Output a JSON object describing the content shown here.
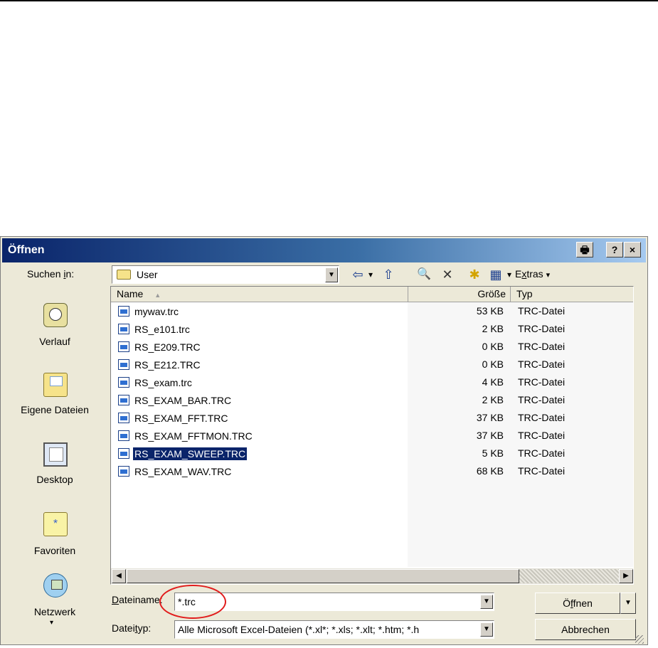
{
  "dialog": {
    "title": "Öffnen",
    "title_buttons": {
      "print": "🖶",
      "help": "?",
      "close": "×"
    }
  },
  "lookin": {
    "label_pre": "Suchen ",
    "label_u": "i",
    "label_post": "n:",
    "value": "User"
  },
  "toolbar": {
    "back": "⇦",
    "back_dd": "▾",
    "up": "⇧",
    "search": "🔍",
    "delete": "✕",
    "newfolder": "✱",
    "views": "▦",
    "views_dd": "▾",
    "extras_pre": "E",
    "extras_u": "x",
    "extras_post": "tras",
    "extras_dd": "▾"
  },
  "places": [
    {
      "label": "Verlauf",
      "icon": "history-icon"
    },
    {
      "label": "Eigene Dateien",
      "icon": "my-documents-icon"
    },
    {
      "label": "Desktop",
      "icon": "desktop-icon"
    },
    {
      "label": "Favoriten",
      "icon": "favorites-icon"
    },
    {
      "label": "Netzwerk",
      "icon": "network-icon"
    }
  ],
  "places_more": "▾",
  "columns": {
    "name": "Name",
    "sort_glyph": "▲",
    "size": "Größe",
    "type": "Typ"
  },
  "files": [
    {
      "name": "mywav.trc",
      "size": "53 KB",
      "type": "TRC-Datei"
    },
    {
      "name": "RS_e101.trc",
      "size": "2 KB",
      "type": "TRC-Datei"
    },
    {
      "name": "RS_E209.TRC",
      "size": "0 KB",
      "type": "TRC-Datei"
    },
    {
      "name": "RS_E212.TRC",
      "size": "0 KB",
      "type": "TRC-Datei"
    },
    {
      "name": "RS_exam.trc",
      "size": "4 KB",
      "type": "TRC-Datei"
    },
    {
      "name": "RS_EXAM_BAR.TRC",
      "size": "2 KB",
      "type": "TRC-Datei"
    },
    {
      "name": "RS_EXAM_FFT.TRC",
      "size": "37 KB",
      "type": "TRC-Datei"
    },
    {
      "name": "RS_EXAM_FFTMON.TRC",
      "size": "37 KB",
      "type": "TRC-Datei"
    },
    {
      "name": "RS_EXAM_SWEEP.TRC",
      "size": "5 KB",
      "type": "TRC-Datei"
    },
    {
      "name": "RS_EXAM_WAV.TRC",
      "size": "68 KB",
      "type": "TRC-Datei"
    }
  ],
  "selected_file": "RS_EXAM_SWEEP.TRC",
  "scrollbar": {
    "left": "◀",
    "right": "▶"
  },
  "filename": {
    "label_u": "D",
    "label_post": "ateiname:",
    "value": "*.trc",
    "dd": "▼"
  },
  "filetype": {
    "label_pre": "Datei",
    "label_u": "t",
    "label_post": "yp:",
    "value": "Alle Microsoft Excel-Dateien (*.xl*; *.xls; *.xlt; *.htm; *.h",
    "dd": "▼"
  },
  "buttons": {
    "open_pre": "Ö",
    "open_u": "f",
    "open_post": "fnen",
    "open_dd": "▼",
    "cancel": "Abbrechen"
  },
  "colors": {
    "title_start": "#0a246a",
    "title_end": "#a6caf0",
    "selection": "#0a246a",
    "highlight": "#e11b1b"
  }
}
